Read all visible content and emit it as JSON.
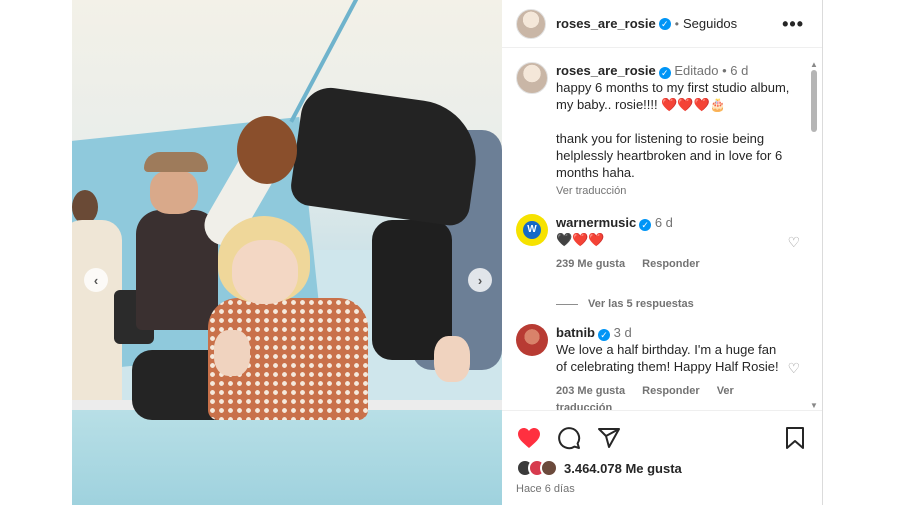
{
  "header": {
    "username": "roses_are_rosie",
    "separator": "•",
    "follow_status": "Seguidos",
    "more_icon": "more-horizontal-icon"
  },
  "caption": {
    "username": "roses_are_rosie",
    "edited": "Editado",
    "separator": "•",
    "age": "6 d",
    "text_line1": "happy 6 months to my first studio album, my baby.. rosie!!!! ❤️❤️❤️🎂",
    "text_line2": "thank you for listening to rosie being helplessly heartbroken and in love for 6 months haha.",
    "translate": "Ver traducción"
  },
  "comments": [
    {
      "username": "warnermusic",
      "age": "6 d",
      "text": "🖤❤️❤️",
      "likes": "239 Me gusta",
      "reply": "Responder",
      "view_replies": "Ver las 5 respuestas"
    },
    {
      "username": "batnib",
      "age": "3 d",
      "text": "We love a half birthday. I'm a huge fan of celebrating them! Happy Half Rosie!",
      "likes": "203 Me gusta",
      "reply": "Responder",
      "translate": "Ver traducción"
    }
  ],
  "actions": {
    "like_icon": "heart-filled-icon",
    "comment_icon": "comment-icon",
    "share_icon": "share-icon",
    "save_icon": "bookmark-icon",
    "like_count": "3.464.078 Me gusta",
    "timestamp": "Hace 6 días"
  },
  "colors": {
    "like_red": "#ff3040",
    "verified_blue": "#0095f6",
    "secondary_text": "#737373"
  }
}
